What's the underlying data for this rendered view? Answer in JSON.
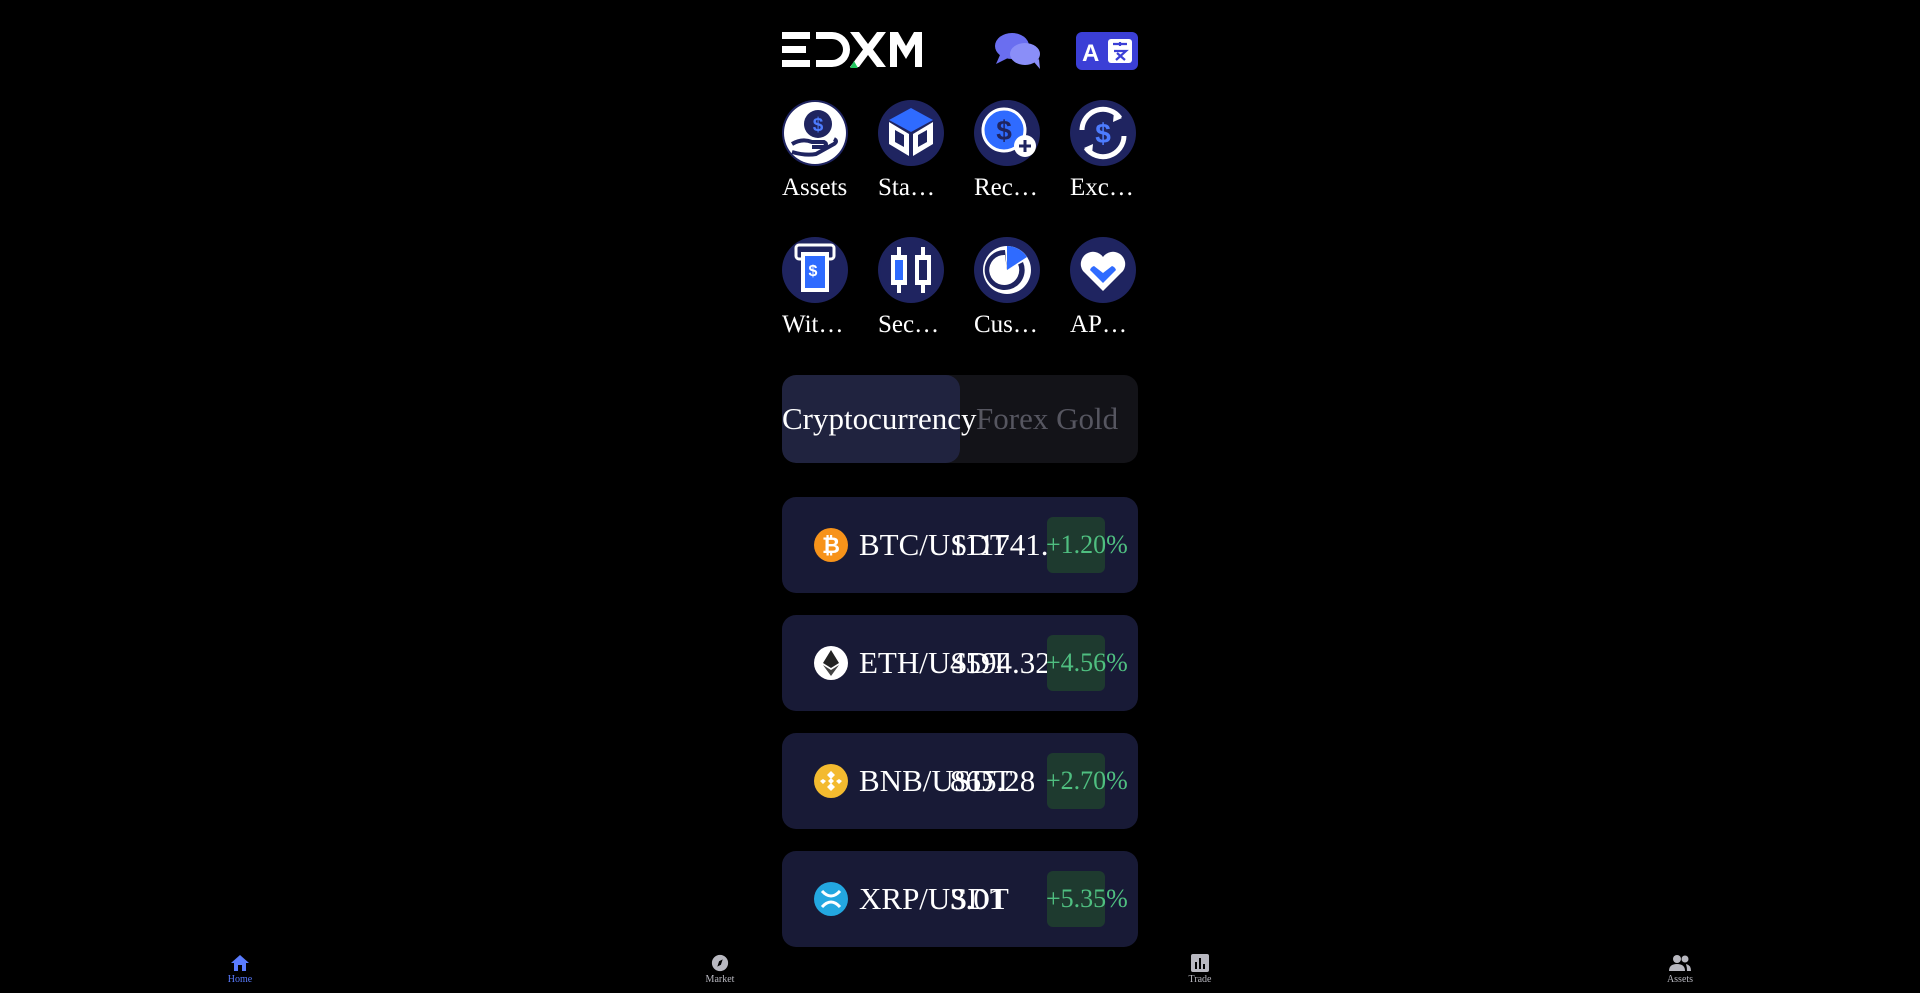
{
  "header": {
    "logo_text": "EDXM"
  },
  "menu": [
    {
      "label": "Assets",
      "icon": "hand-coin-icon"
    },
    {
      "label": "Sta…",
      "icon": "cube-icon"
    },
    {
      "label": "Rec…",
      "icon": "dollar-plus-icon"
    },
    {
      "label": "Exc…",
      "icon": "exchange-icon"
    },
    {
      "label": "Wit…",
      "icon": "withdraw-icon"
    },
    {
      "label": "Sec…",
      "icon": "candlestick-icon"
    },
    {
      "label": "Cus…",
      "icon": "pie-icon"
    },
    {
      "label": "AP…",
      "icon": "heart-icon"
    }
  ],
  "tabs": {
    "active": "Cryptocurrency",
    "inactive": "Forex Gold"
  },
  "tickers": [
    {
      "pair": "BTC/USDT",
      "price": "111741.",
      "change": "+1.20%",
      "color": "#f7931a"
    },
    {
      "pair": "ETH/USDT",
      "price": "4594.32",
      "change": "+4.56%",
      "color": "#ffffff"
    },
    {
      "pair": "BNB/USDT",
      "price": "865.28",
      "change": "+2.70%",
      "color": "#f3ba2f"
    },
    {
      "pair": "XRP/USDT",
      "price": "3.01",
      "change": "+5.35%",
      "color": "#23a7e0"
    }
  ],
  "bottom_nav": [
    {
      "label": "Home",
      "icon": "home-icon"
    },
    {
      "label": "Market",
      "icon": "compass-icon"
    },
    {
      "label": "Trade",
      "icon": "chart-icon"
    },
    {
      "label": "Assets",
      "icon": "users-icon"
    }
  ],
  "colors": {
    "accent": "#3b3fd6",
    "positive": "#4fbf80",
    "card_bg": "#181a36"
  }
}
